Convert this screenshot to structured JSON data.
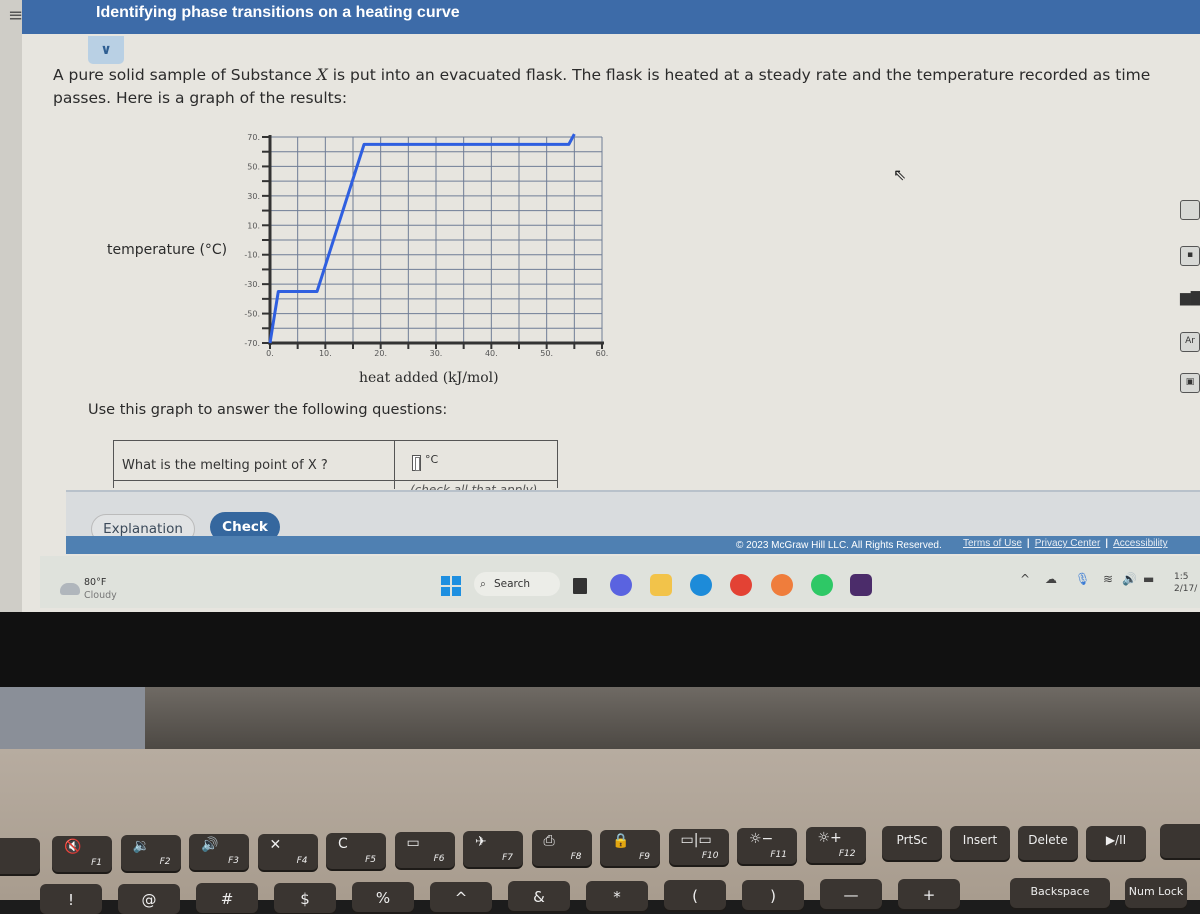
{
  "app": {
    "title": "Identifying phase transitions on a heating curve",
    "menu_icon": "hamburger-icon",
    "collapse_icon": "chevron-down-icon"
  },
  "problem": {
    "intro_part1": "A pure solid sample of Substance ",
    "intro_var": "X",
    "intro_part2": " is put into an evacuated flask. The flask is heated at a steady rate and the temperature recorded as time passes. Here is a graph of the results:",
    "use_graph": "Use this graph to answer the following questions:",
    "question_1": "What is the melting point of X ?",
    "answer_1_value": "",
    "answer_1_unit": "°C",
    "question_2_hint": "(check all that apply)"
  },
  "chart_data": {
    "type": "line",
    "title": "",
    "xlabel": "heat added (kJ/mol)",
    "ylabel": "temperature (°C)",
    "xlim": [
      0,
      60
    ],
    "ylim": [
      -70,
      70
    ],
    "x_ticks": [
      "0.",
      "10.",
      "20.",
      "30.",
      "40.",
      "50.",
      "60."
    ],
    "y_ticks": [
      "70.",
      "50.",
      "30.",
      "10.",
      "-10.",
      "-30.",
      "-50.",
      "-70."
    ],
    "grid": true,
    "series": [
      {
        "name": "heating curve",
        "color": "#2f5fe0",
        "x": [
          0,
          1.5,
          8.5,
          17,
          54,
          55
        ],
        "y": [
          -70,
          -35,
          -35,
          65,
          65,
          72
        ]
      }
    ]
  },
  "buttons": {
    "explanation": "Explanation",
    "check": "Check"
  },
  "footer": {
    "copyright": "© 2023 McGraw Hill LLC. All Rights Reserved.",
    "links": [
      "Terms of Use",
      "Privacy Center",
      "Accessibility"
    ]
  },
  "sidebar_tools": [
    "calculator-icon",
    "data-icon",
    "chart-icon",
    "periodic-table-icon",
    "tablet-icon"
  ],
  "sidebar_tool_labels": [
    "",
    "",
    "",
    "Ar",
    ""
  ],
  "taskbar": {
    "weather_temp": "80°F",
    "weather_desc": "Cloudy",
    "search_label": "Search",
    "clock_time": "1:5",
    "clock_date": "2/17/"
  },
  "keyboard": {
    "fn_row": [
      {
        "sym": "🔇",
        "fn": "F1"
      },
      {
        "sym": "🔉",
        "fn": "F2"
      },
      {
        "sym": "🔊",
        "fn": "F3"
      },
      {
        "sym": "✕",
        "fn": "F4"
      },
      {
        "sym": "C",
        "fn": "F5"
      },
      {
        "sym": "▭",
        "fn": "F6"
      },
      {
        "sym": "✈",
        "fn": "F7"
      },
      {
        "sym": "⎙",
        "fn": "F8"
      },
      {
        "sym": "🔒",
        "fn": "F9"
      },
      {
        "sym": "▭|▭",
        "fn": "F10"
      },
      {
        "sym": "☼−",
        "fn": "F11"
      },
      {
        "sym": "☼+",
        "fn": "F12"
      }
    ],
    "named_keys": [
      "PrtSc",
      "Insert",
      "Delete",
      "▶/II"
    ],
    "number_row": [
      "!",
      "@",
      "#",
      "$",
      "%",
      "^",
      "&",
      "*",
      "(",
      ")",
      "—",
      "+",
      "Backspace",
      "Num Lock"
    ]
  }
}
